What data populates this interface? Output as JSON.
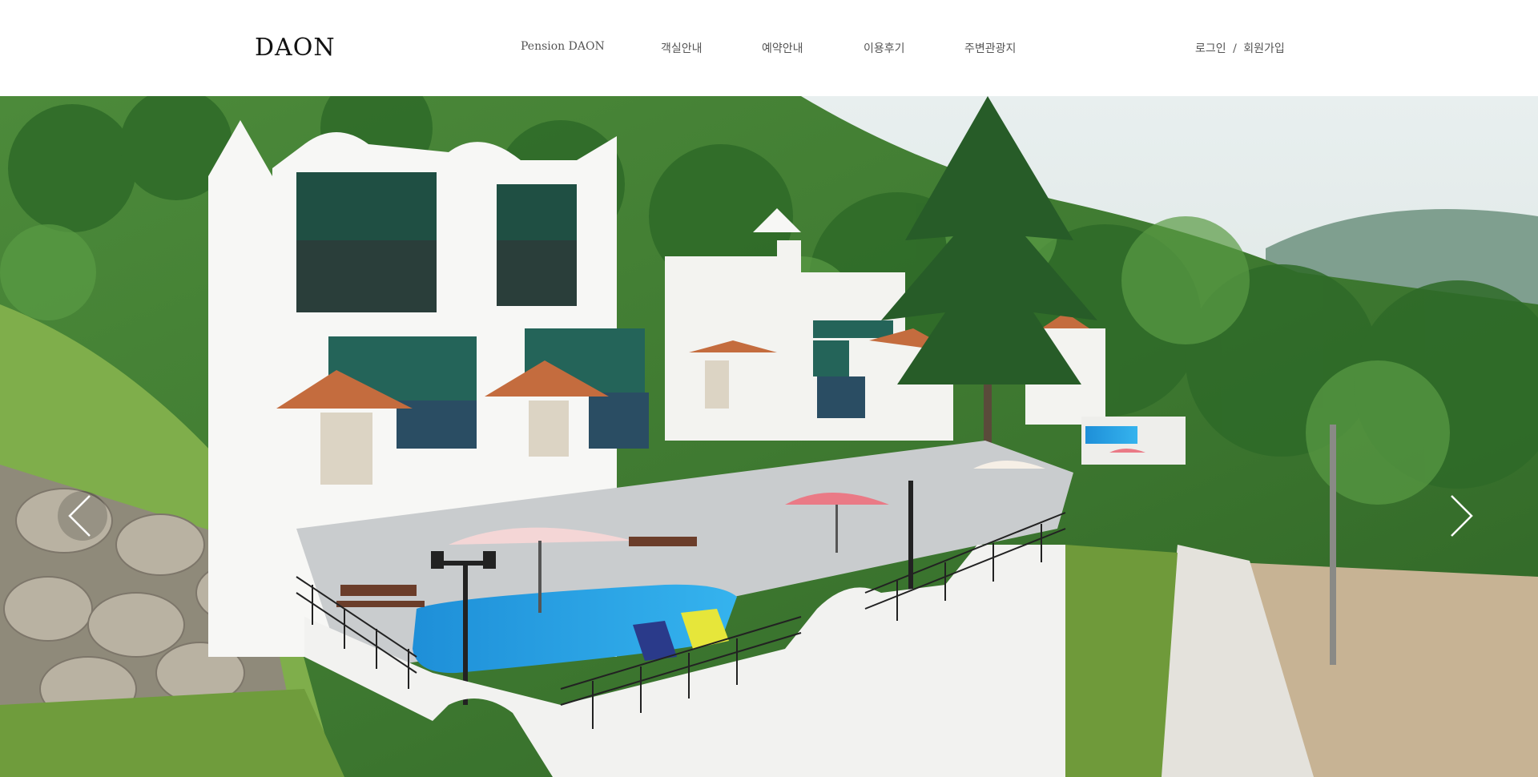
{
  "header": {
    "logo": "DAON",
    "nav": [
      {
        "label": "Pension DAON"
      },
      {
        "label": "객실안내"
      },
      {
        "label": "예약안내"
      },
      {
        "label": "이용후기"
      },
      {
        "label": "주변관광지"
      }
    ],
    "auth": {
      "login": "로그인",
      "separator": "/",
      "signup": "회원가입"
    }
  },
  "hero": {
    "image": "pension-villa-photo",
    "prev_icon": "chevron-left-icon",
    "next_icon": "chevron-right-icon"
  },
  "colors": {
    "header_bg": "#ffffff",
    "nav_text": "#555555",
    "logo_text": "#111111",
    "pool": "#1f9fe0"
  }
}
